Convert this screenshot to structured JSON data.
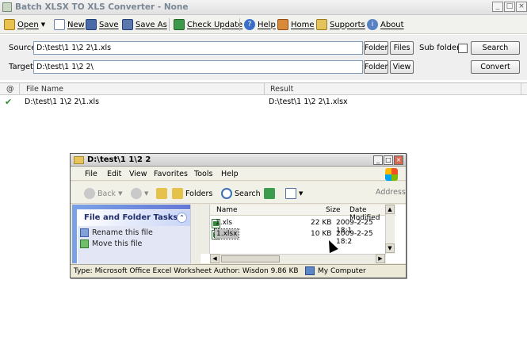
{
  "window": {
    "title": "Batch XLSX TO XLS Converter - None",
    "buttons": [
      "_",
      "□",
      "×"
    ]
  },
  "toolbar": {
    "open": "Open",
    "new": "New",
    "save": "Save",
    "save_as": "Save As",
    "check_update": "Check Update",
    "help": "Help",
    "home": "Home",
    "supports": "Supports",
    "about": "About"
  },
  "panel": {
    "source_label": "Source",
    "source_value": "D:\\test\\1 1\\2 2\\1.xls",
    "target_label": "Target",
    "target_value": "D:\\test\\1 1\\2 2\\",
    "folder_button": "Folder",
    "files_button": "Files",
    "view_button": "View",
    "subfolders_label": "Sub folders",
    "search_button": "Search",
    "convert_button": "Convert"
  },
  "grid": {
    "columns": [
      "@",
      "File Name",
      "Result"
    ],
    "rows": [
      {
        "status": "✔",
        "file": "D:\\test\\1 1\\2 2\\1.xls",
        "result": "D:\\test\\1 1\\2 2\\1.xlsx"
      }
    ]
  },
  "explorer": {
    "title": "D:\\test\\1 1\\2 2",
    "menu": [
      "File",
      "Edit",
      "View",
      "Favorites",
      "Tools",
      "Help"
    ],
    "tools": {
      "back": "Back",
      "folders": "Folders",
      "search": "Search",
      "address": "Address"
    },
    "tasks_title": "File and Folder Tasks",
    "tasks": [
      "Rename this file",
      "Move this file"
    ],
    "list_columns": [
      "Name",
      "Size",
      "Date Modified"
    ],
    "files": [
      {
        "name": "1.xls",
        "size": "22 KB",
        "date": "2009-2-25 18:1"
      },
      {
        "name": "1.xlsx",
        "size": "10 KB",
        "date": "2009-2-25 18:2"
      }
    ],
    "status_text": "Type: Microsoft Office Excel Worksheet Author: Wisdon 9.86 KB",
    "status_location": "My Computer"
  },
  "colors": {
    "accent": "#7ba2e7",
    "check": "#2f8b2f",
    "close": "#d56a55"
  }
}
